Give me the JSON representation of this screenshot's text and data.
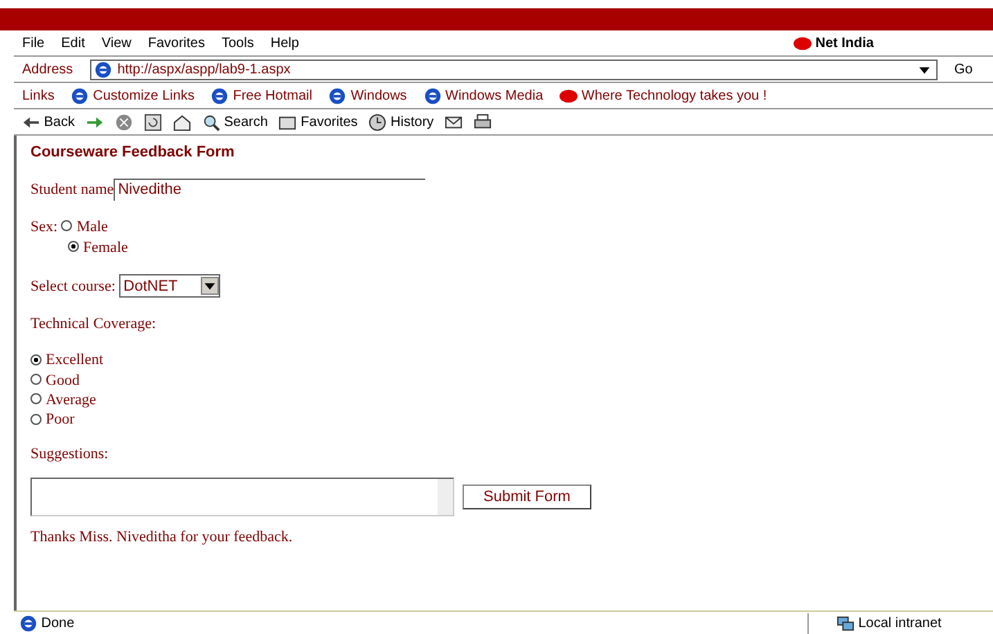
{
  "menu": [
    "File",
    "Edit",
    "View",
    "Favorites",
    "Tools",
    "Help"
  ],
  "brand": "Net India",
  "address": {
    "label": "Address",
    "value": "http://aspx/aspp/lab9-1.aspx",
    "go": "Go"
  },
  "links": {
    "label": "Links",
    "items": [
      "Customize Links",
      "Free Hotmail",
      "Windows",
      "Windows Media",
      "Where Technology takes you !"
    ]
  },
  "toolbar": [
    {
      "kind": "back",
      "label": "Back"
    },
    {
      "kind": "forward"
    },
    {
      "kind": "stop"
    },
    {
      "kind": "refresh"
    },
    {
      "kind": "home"
    },
    {
      "kind": "search",
      "label": "Search"
    },
    {
      "kind": "favorites",
      "label": "Favorites"
    },
    {
      "kind": "history",
      "label": "History"
    },
    {
      "kind": "mail"
    },
    {
      "kind": "print"
    }
  ],
  "form": {
    "title": "Courseware Feedback Form",
    "name_label": "Student name",
    "name_value": "Nivedithe",
    "sex_label": "Sex:",
    "sex_options": [
      {
        "label": "Male",
        "selected": false
      },
      {
        "label": "Female",
        "selected": true
      }
    ],
    "course_label": "Select course:",
    "course_value": "DotNET",
    "coverage_label": "Technical Coverage:",
    "coverage_options": [
      {
        "label": "Excellent",
        "selected": true
      },
      {
        "label": "Good",
        "selected": false
      },
      {
        "label": "Average",
        "selected": false
      },
      {
        "label": "Poor",
        "selected": false
      }
    ],
    "suggestions_label": "Suggestions:",
    "submit": "Submit Form",
    "thanks": "Thanks Miss. Niveditha for your feedback."
  },
  "status": {
    "text": "Done",
    "zone": "Local intranet"
  }
}
